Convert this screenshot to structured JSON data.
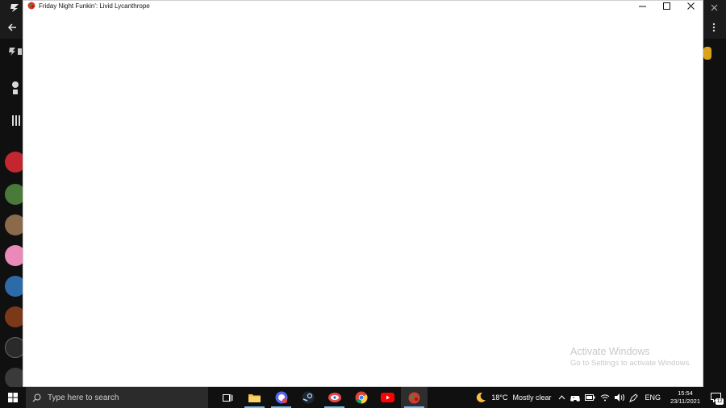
{
  "window": {
    "title": "Friday Night Funkin': Livid Lycanthrope",
    "minimize_icon": "minimize-icon",
    "maximize_icon": "maximize-icon",
    "close_icon": "close-icon"
  },
  "watermark": {
    "title": "Activate Windows",
    "subtitle": "Go to Settings to activate Windows."
  },
  "taskbar": {
    "search_placeholder": "Type here to search",
    "apps": [
      "task-view",
      "file-explorer",
      "chat-app",
      "steam",
      "game-launcher",
      "chrome",
      "youtube",
      "fnf-game"
    ],
    "weather": {
      "temperature": "18°C",
      "condition": "Mostly clear"
    },
    "language": "ENG",
    "time": "15:54",
    "date": "23/11/2021",
    "notifications_count": "12"
  },
  "colors": {
    "taskbar_bg": "#101010",
    "window_bg": "#ffffff",
    "accent": "#76b9ed"
  }
}
